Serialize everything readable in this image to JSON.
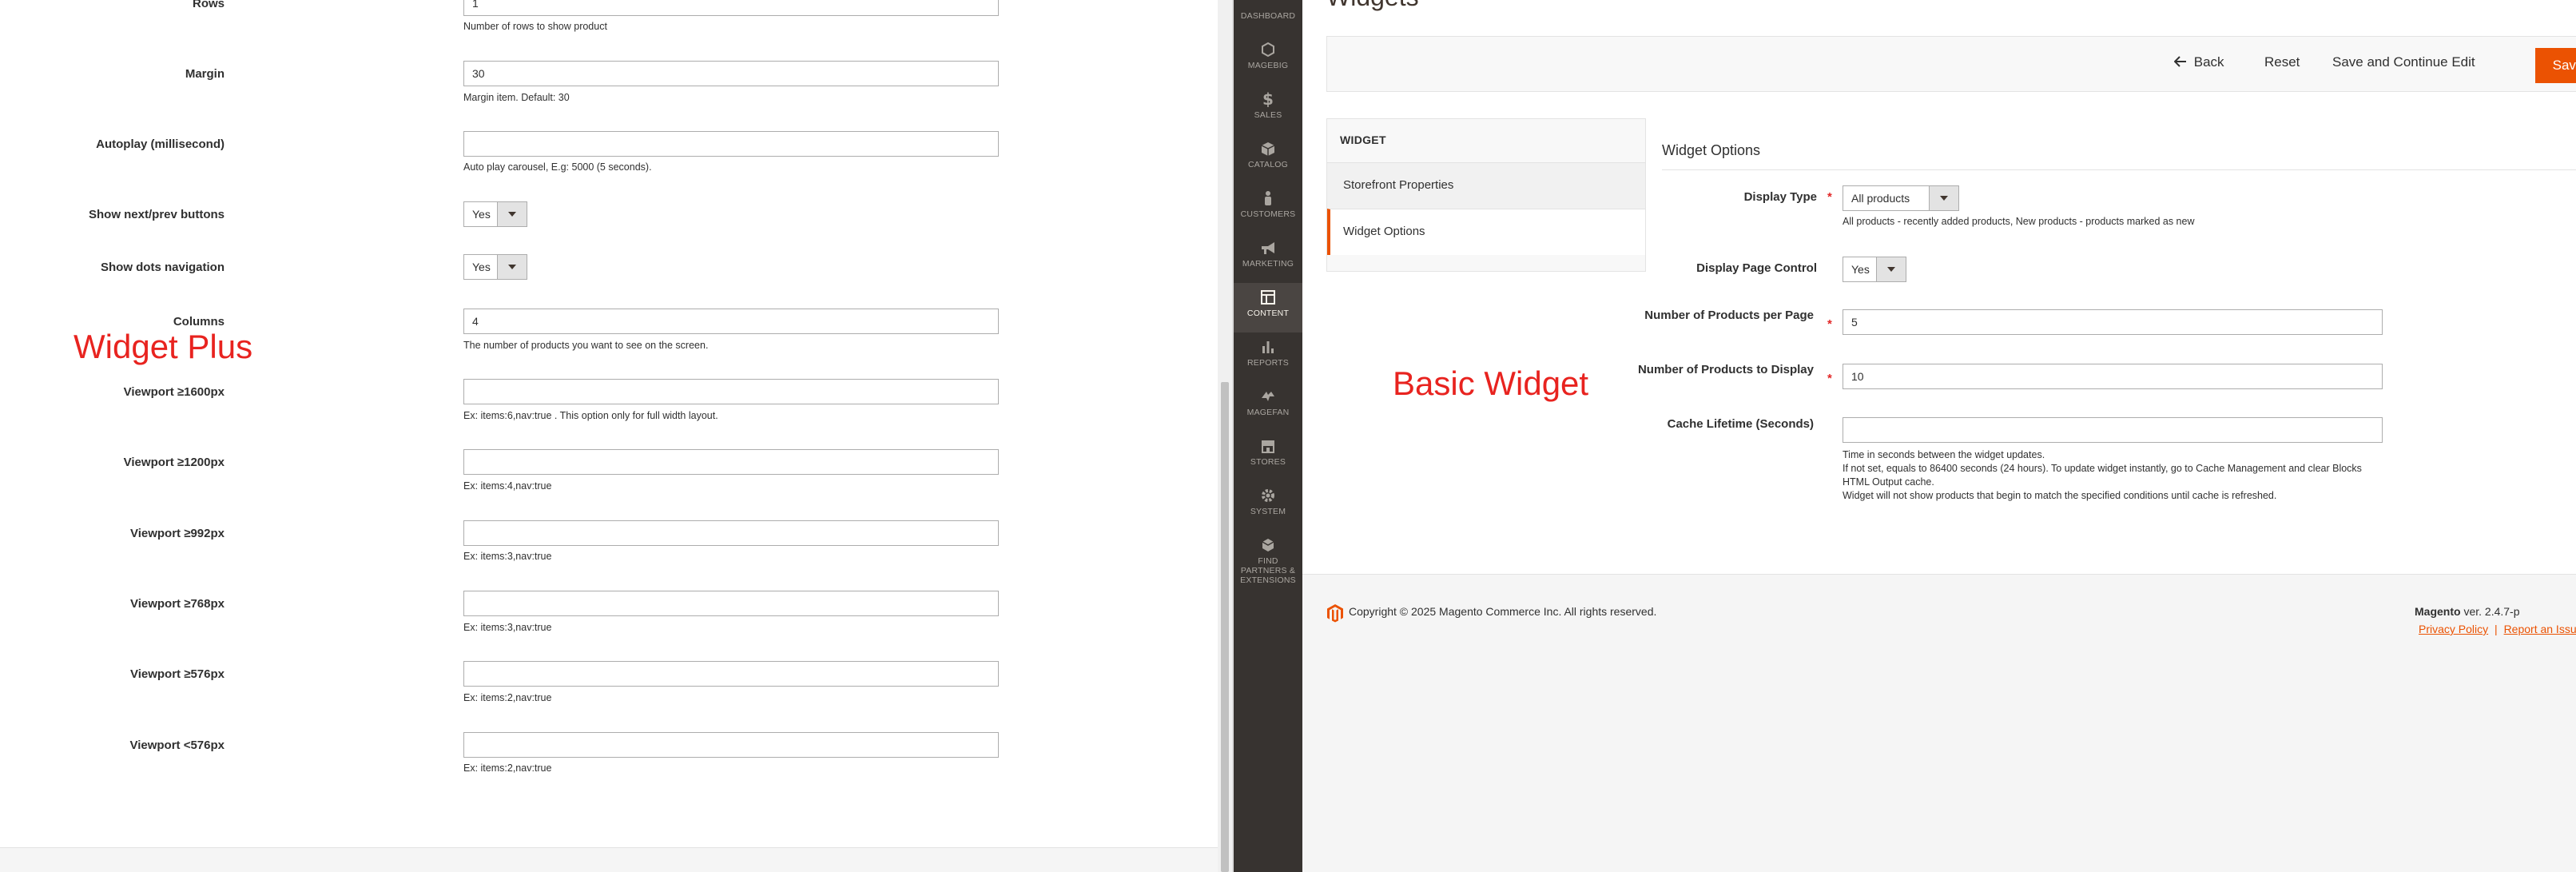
{
  "left": {
    "fields": [
      {
        "label": "Rows",
        "value": "1",
        "note": "Number of rows to show product"
      },
      {
        "label": "Margin",
        "value": "30",
        "note": "Margin item. Default: 30"
      },
      {
        "label": "Autoplay (millisecond)",
        "value": "",
        "note": "Auto play carousel, E.g: 5000 (5 seconds)."
      },
      {
        "label": "Show next/prev buttons",
        "value": "Yes",
        "type": "select"
      },
      {
        "label": "Show dots navigation",
        "value": "Yes",
        "type": "select"
      },
      {
        "label": "Columns",
        "value": "4",
        "note": "The number of products you want to see on the screen."
      },
      {
        "label": "Viewport ≥1600px",
        "value": "",
        "note": "Ex: items:6,nav:true . This option only for full width layout."
      },
      {
        "label": "Viewport ≥1200px",
        "value": "",
        "note": "Ex: items:4,nav:true"
      },
      {
        "label": "Viewport ≥992px",
        "value": "",
        "note": "Ex: items:3,nav:true"
      },
      {
        "label": "Viewport ≥768px",
        "value": "",
        "note": "Ex: items:3,nav:true"
      },
      {
        "label": "Viewport ≥576px",
        "value": "",
        "note": "Ex: items:2,nav:true"
      },
      {
        "label": "Viewport <576px",
        "value": "",
        "note": "Ex: items:2,nav:true"
      }
    ],
    "caption": "Widget Plus"
  },
  "menu": {
    "items": [
      {
        "label": "DASHBOARD",
        "icon": "dashboard-icon"
      },
      {
        "label": "MAGEBIG",
        "icon": "hexagon-icon"
      },
      {
        "label": "SALES",
        "icon": "dollar-icon"
      },
      {
        "label": "CATALOG",
        "icon": "box-icon"
      },
      {
        "label": "CUSTOMERS",
        "icon": "person-icon"
      },
      {
        "label": "MARKETING",
        "icon": "megaphone-icon"
      },
      {
        "label": "CONTENT",
        "icon": "layout-icon"
      },
      {
        "label": "REPORTS",
        "icon": "bar-chart-icon"
      },
      {
        "label": "MAGEFAN",
        "icon": "magefan-icon"
      },
      {
        "label": "STORES",
        "icon": "store-icon"
      },
      {
        "label": "SYSTEM",
        "icon": "gear-icon"
      },
      {
        "label": "FIND PARTNERS & EXTENSIONS",
        "icon": "extensions-icon"
      }
    ],
    "active": "CONTENT"
  },
  "right": {
    "page_title": "Widgets",
    "actions": {
      "back": "Back",
      "reset": "Reset",
      "save_continue": "Save and Continue Edit",
      "save": "Save"
    },
    "tabs_title": "WIDGET",
    "tabs": [
      "Storefront Properties",
      "Widget Options"
    ],
    "fieldset_title": "Widget Options",
    "display_type": {
      "label": "Display Type",
      "value": "All products",
      "note": "All products - recently added products, New products - products marked as new"
    },
    "page_control": {
      "label": "Display Page Control",
      "value": "Yes"
    },
    "per_page": {
      "label": "Number of Products per Page",
      "value": "5"
    },
    "to_display": {
      "label": "Number of Products to Display",
      "value": "10"
    },
    "cache": {
      "label": "Cache Lifetime (Seconds)",
      "value": "",
      "note1": "Time in seconds between the widget updates.",
      "note2": "If not set, equals to 86400 seconds (24 hours). To update widget instantly, go to Cache Management and clear Blocks HTML Output cache.",
      "note3": "Widget will not show products that begin to match the specified conditions until cache is refreshed."
    },
    "caption": "Basic Widget",
    "footer": {
      "copyright": "Copyright © 2025 Magento Commerce Inc. All rights reserved.",
      "brand": "Magento",
      "version": " ver. 2.4.7-p",
      "privacy": "Privacy Policy",
      "sep": "|",
      "report": "Report an Issu"
    }
  },
  "colors": {
    "accent": "#eb5202",
    "caption_red": "#e8231f",
    "menu_bg": "#373330"
  }
}
